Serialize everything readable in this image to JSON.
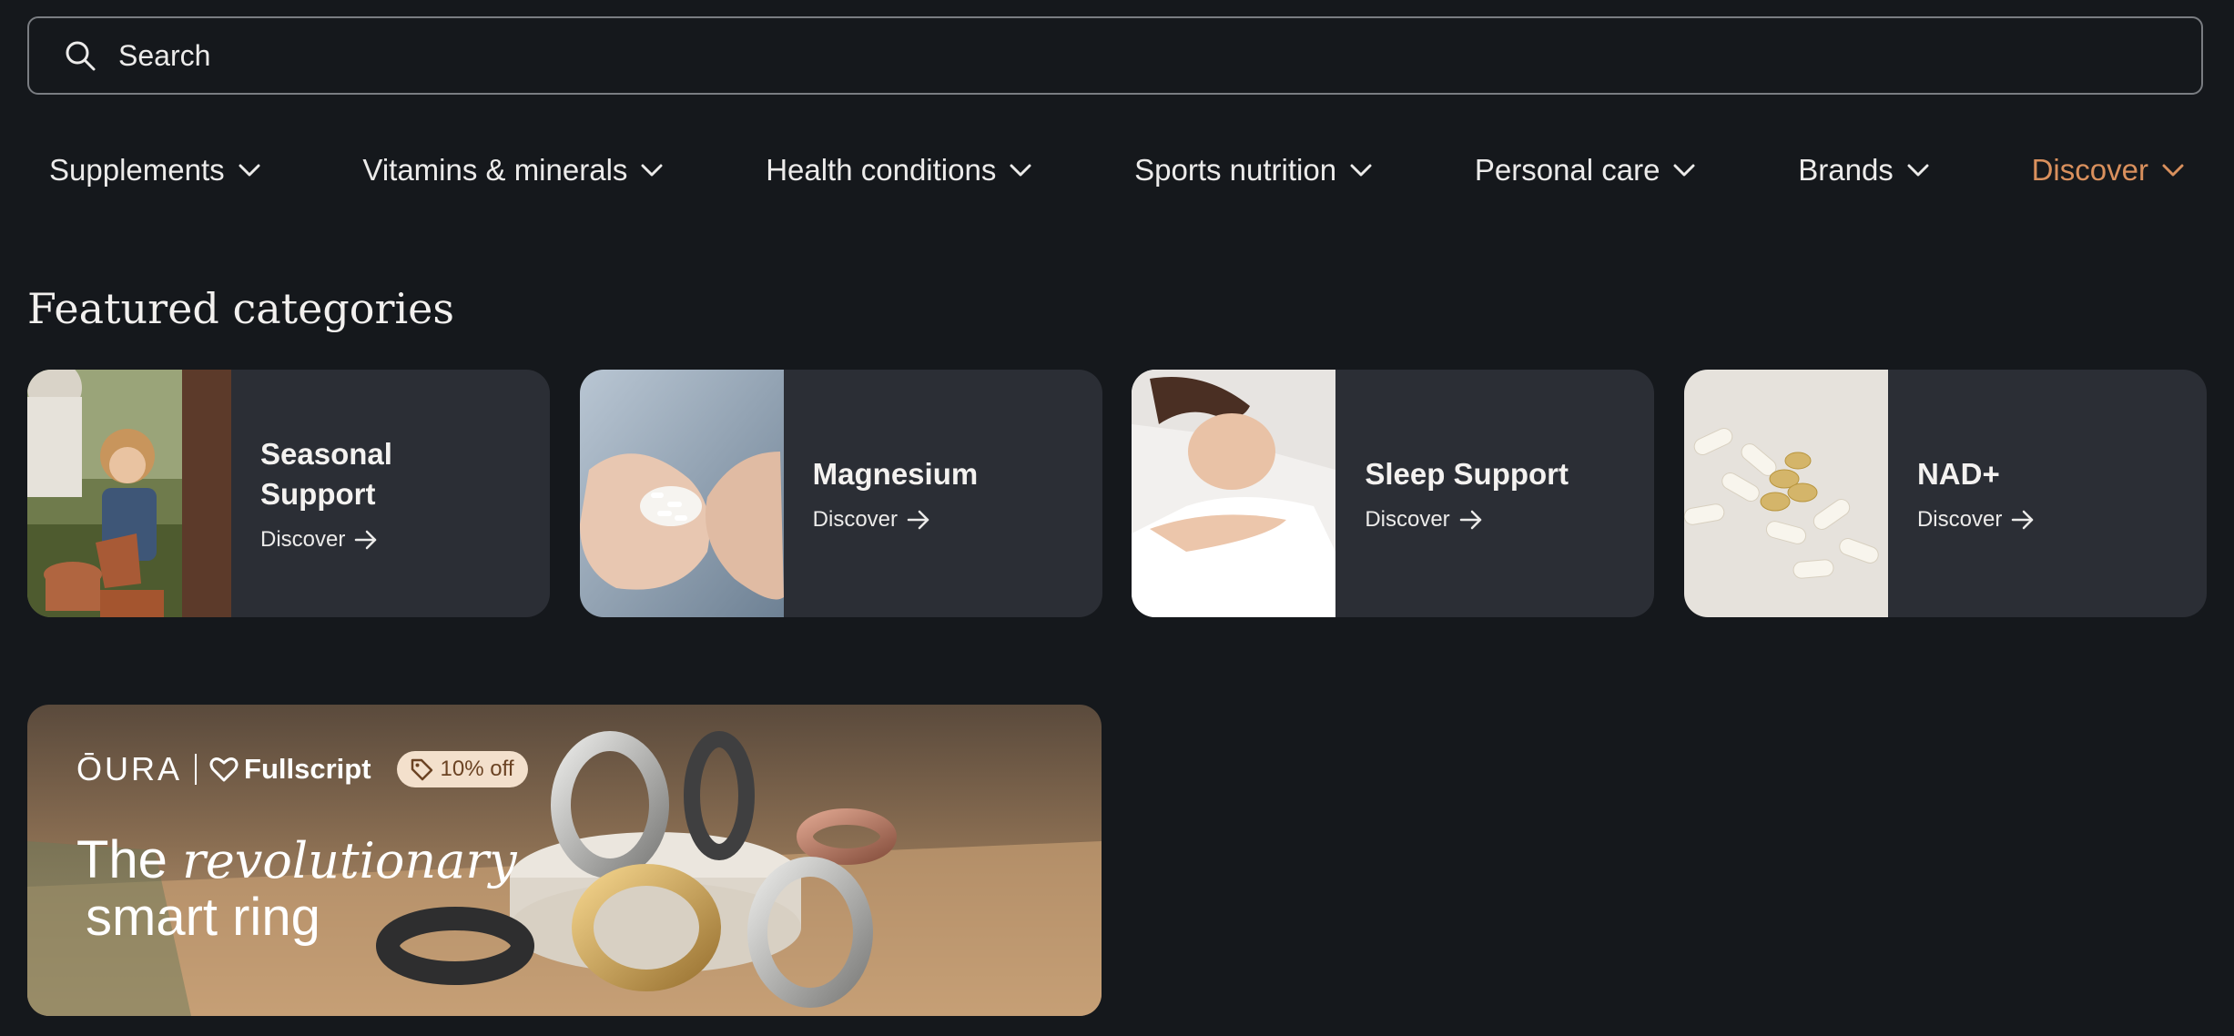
{
  "search": {
    "placeholder": "Search",
    "icon": "search-icon"
  },
  "nav": {
    "items": [
      {
        "label": "Supplements",
        "active": false
      },
      {
        "label": "Vitamins & minerals",
        "active": false
      },
      {
        "label": "Health conditions",
        "active": false
      },
      {
        "label": "Sports nutrition",
        "active": false
      },
      {
        "label": "Personal care",
        "active": false
      },
      {
        "label": "Brands",
        "active": false
      },
      {
        "label": "Discover",
        "active": true
      }
    ],
    "active_color": "#d9905d"
  },
  "featured": {
    "title": "Featured categories",
    "cards": [
      {
        "label": "Seasonal Support",
        "cta": "Discover",
        "image": "family-gardening-photo"
      },
      {
        "label": "Magnesium",
        "cta": "Discover",
        "image": "hands-holding-capsules-photo"
      },
      {
        "label": "Sleep Support",
        "cta": "Discover",
        "image": "woman-sleeping-photo"
      },
      {
        "label": "NAD+",
        "cta": "Discover",
        "image": "capsules-photo"
      }
    ]
  },
  "banner": {
    "brand_oura": "ŌURA",
    "brand_partner": "Fullscript",
    "badge": "10% off",
    "headline_word1": "The",
    "headline_italic": "revolutionary",
    "headline_line2": "smart ring",
    "image": "oura-rings-photo"
  },
  "colors": {
    "background": "#15181c",
    "card": "#2b2e35",
    "accent": "#d9905d",
    "badge_bg": "#f3e0cc"
  }
}
